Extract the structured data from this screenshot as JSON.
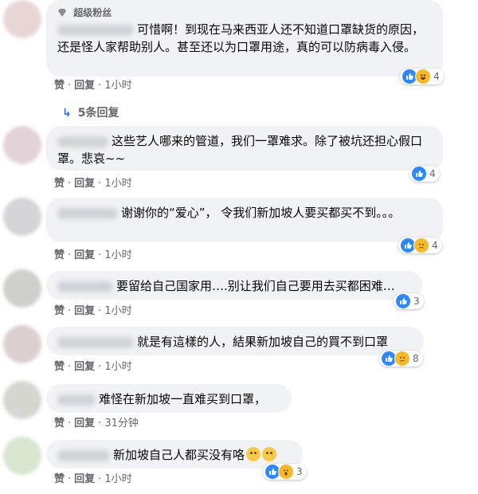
{
  "thread": {
    "comments": [
      {
        "badge": "超级粉丝",
        "text": "可惜啊！到现在马来西亚人还不知道口罩缺货的原因，还是怪人家帮助别人。甚至还以为口罩用途，真的可以防病毒入侵。",
        "actions": {
          "like": "赞",
          "reply": "回复",
          "time": "1小时"
        },
        "reactions": {
          "icons": [
            "like-icon",
            "haha-icon"
          ],
          "count": "4"
        },
        "replies_label": "5条回复"
      },
      {
        "text": "这些艺人哪来的管道，我们一罩难求。除了被坑还担心假口罩。悲哀~~",
        "actions": {
          "like": "赞",
          "reply": "回复",
          "time": "1小时"
        },
        "reactions": {
          "icons": [
            "like-icon"
          ],
          "count": "4"
        }
      },
      {
        "text": "谢谢你的“爱心”， 令我们新加坡人要买都买不到。。。",
        "actions": {
          "like": "赞",
          "reply": "回复",
          "time": "1小时"
        },
        "reactions": {
          "icons": [
            "like-icon",
            "sad-icon"
          ],
          "count": "4"
        }
      },
      {
        "text": "要留给自己国家用….别让我们自己要用去买都困难…",
        "actions": {
          "like": "赞",
          "reply": "回复",
          "time": "1小时"
        },
        "reactions": {
          "icons": [
            "like-icon"
          ],
          "count": "3"
        }
      },
      {
        "text": "就是有這樣的人，結果新加坡自己的買不到口罩",
        "actions": {
          "like": "赞",
          "reply": "回复",
          "time": "1小时"
        },
        "reactions": {
          "icons": [
            "like-icon",
            "sad-icon"
          ],
          "count": "8"
        }
      },
      {
        "text": "难怪在新加坡一直难买到口罩，",
        "actions": {
          "like": "赞",
          "reply": "回复",
          "time": "31分钟"
        },
        "reactions": null
      },
      {
        "text": "新加坡自己人都买没有咯",
        "actions": {
          "like": "赞",
          "reply": "回复",
          "time": "1小时"
        },
        "reactions": {
          "icons": [
            "like-icon",
            "wow-icon"
          ],
          "count": "3"
        }
      }
    ]
  },
  "colors": {
    "bubble": "#f0f2f5",
    "meta_text": "#65676b",
    "like_blue": "#2d88ff",
    "reply_link_blue": "#1877f2",
    "emoji_yellow": "#f7b928"
  }
}
